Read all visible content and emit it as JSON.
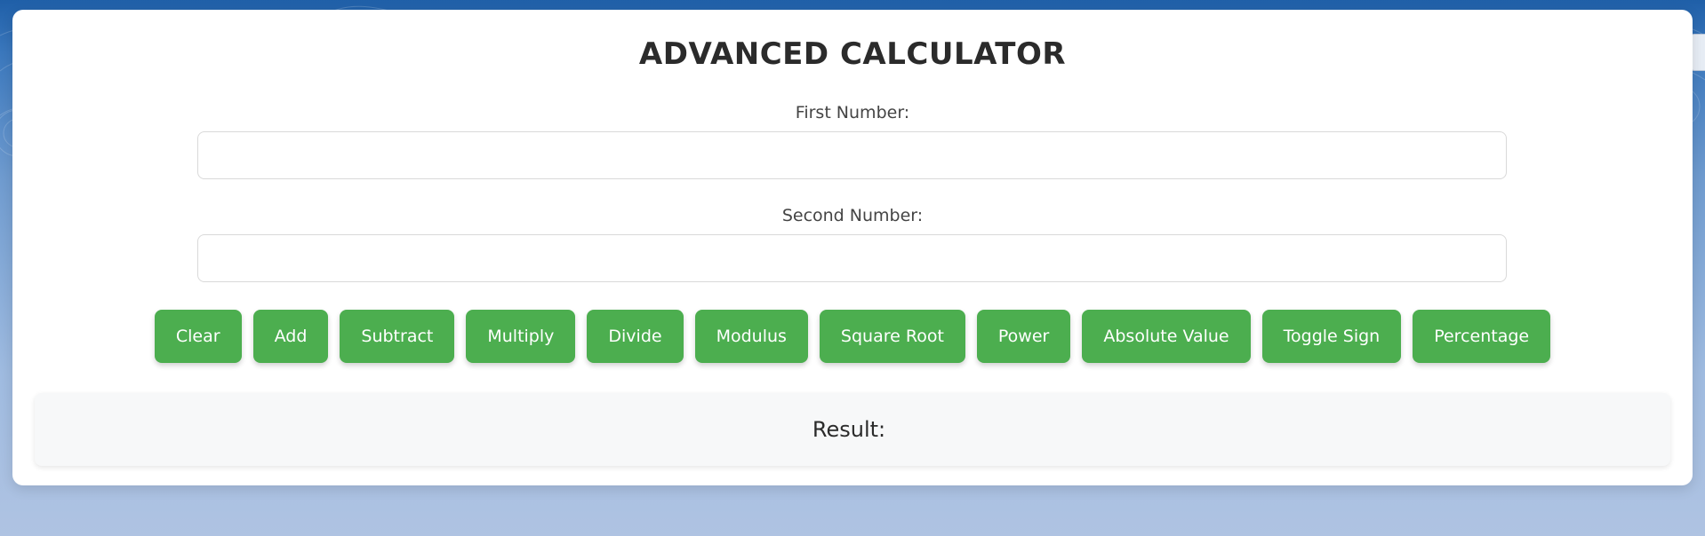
{
  "app": {
    "title": "ADVANCED CALCULATOR"
  },
  "fields": {
    "first": {
      "label": "First Number:",
      "value": "",
      "placeholder": ""
    },
    "second": {
      "label": "Second Number:",
      "value": "",
      "placeholder": ""
    }
  },
  "buttons": [
    {
      "id": "clear",
      "label": "Clear"
    },
    {
      "id": "add",
      "label": "Add"
    },
    {
      "id": "subtract",
      "label": "Subtract"
    },
    {
      "id": "multiply",
      "label": "Multiply"
    },
    {
      "id": "divide",
      "label": "Divide"
    },
    {
      "id": "modulus",
      "label": "Modulus"
    },
    {
      "id": "square-root",
      "label": "Square Root"
    },
    {
      "id": "power",
      "label": "Power"
    },
    {
      "id": "absolute-value",
      "label": "Absolute Value"
    },
    {
      "id": "toggle-sign",
      "label": "Toggle Sign"
    },
    {
      "id": "percentage",
      "label": "Percentage"
    }
  ],
  "result": {
    "label": "Result:",
    "value": ""
  },
  "colors": {
    "button_bg": "#4cae4f",
    "button_text": "#ffffff",
    "card_bg": "#ffffff",
    "result_bg": "#f7f8f9",
    "page_bg_top": "#1f5fa8",
    "page_bg_bottom": "#afc3e2"
  }
}
